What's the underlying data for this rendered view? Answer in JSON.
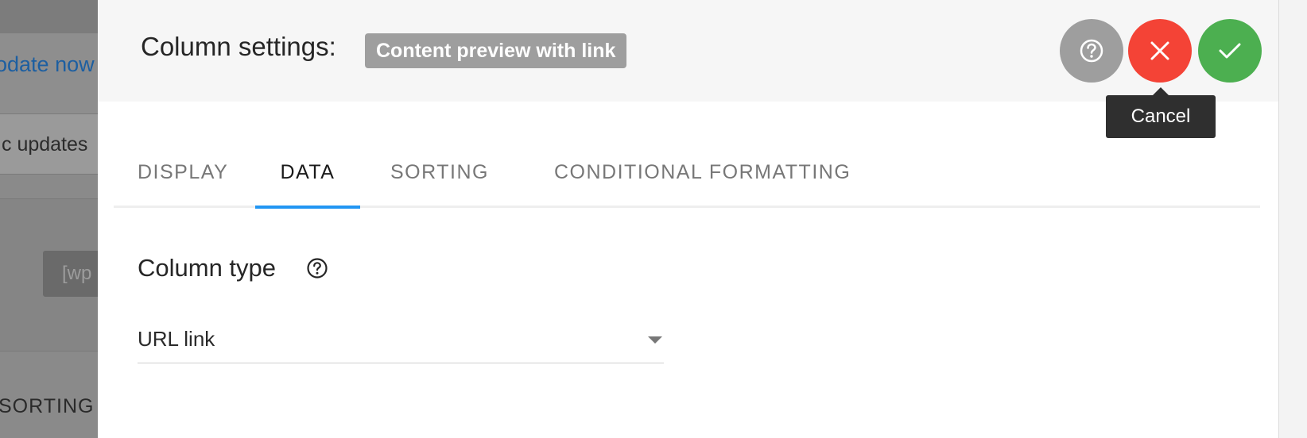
{
  "background": {
    "update_link": "odate now",
    "updates_text": "c updates",
    "shortcode_chip": "[wp",
    "sorting_text": "SORTING A"
  },
  "modal": {
    "title": "Column settings:",
    "title_badge": "Content preview with link",
    "buttons": {
      "help_icon": "help-circle-icon",
      "cancel_icon": "close-icon",
      "confirm_icon": "check-icon"
    },
    "tooltip": "Cancel",
    "colors": {
      "cancel": "#f44336",
      "confirm": "#4caf50",
      "help": "#9e9e9e",
      "tab_active_underline": "#2196f3"
    }
  },
  "tabs": [
    {
      "label": "DISPLAY",
      "active": false
    },
    {
      "label": "DATA",
      "active": true
    },
    {
      "label": "SORTING",
      "active": false
    },
    {
      "label": "CONDITIONAL FORMATTING",
      "active": false
    }
  ],
  "column_type": {
    "label": "Column type",
    "help_icon": "help-circle-icon",
    "selected": "URL link"
  }
}
